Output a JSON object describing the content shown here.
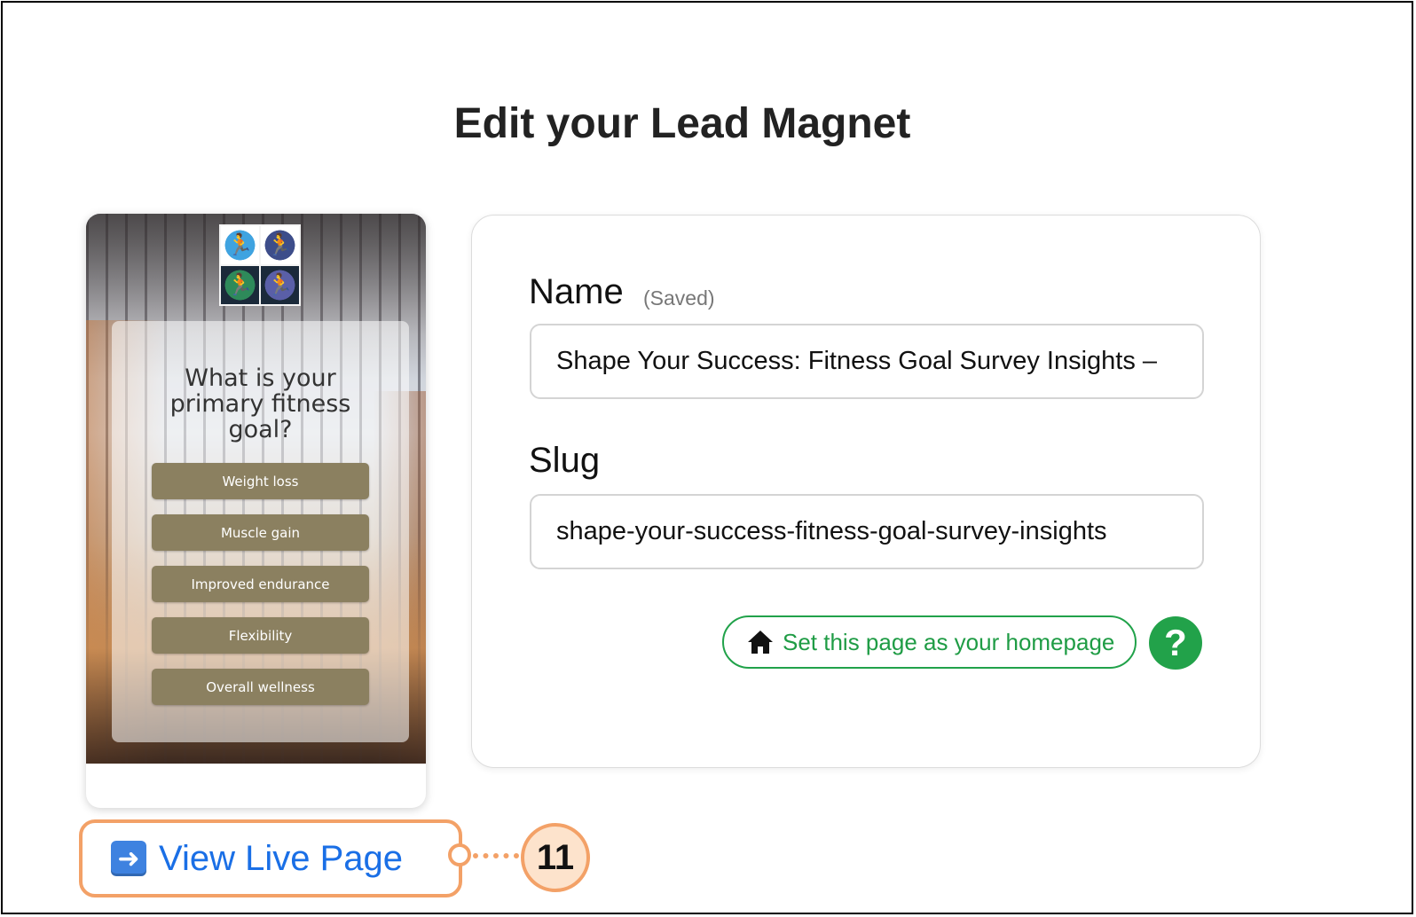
{
  "page": {
    "title": "Edit your Lead Magnet"
  },
  "preview": {
    "logo_icons": [
      "runner-icon",
      "runner-icon",
      "runner-icon",
      "runner-icon"
    ],
    "question": "What is your primary fitness goal?",
    "options": [
      "Weight loss",
      "Muscle gain",
      "Improved endurance",
      "Flexibility",
      "Overall wellness"
    ],
    "option_color": "#8b8060"
  },
  "form": {
    "name_label": "Name",
    "saved_status": "(Saved)",
    "name_value": "Shape Your Success: Fitness Goal Survey Insights –",
    "slug_label": "Slug",
    "slug_value": "shape-your-success-fitness-goal-survey-insights",
    "homepage_button": "Set this page as your homepage",
    "help_button": "?",
    "accent_color": "#22a24a"
  },
  "live_link": {
    "label": "View Live Page",
    "icon": "arrow-right-icon",
    "link_color": "#1a6fe6"
  },
  "callout": {
    "step_number": "11",
    "color": "#f3a167"
  }
}
